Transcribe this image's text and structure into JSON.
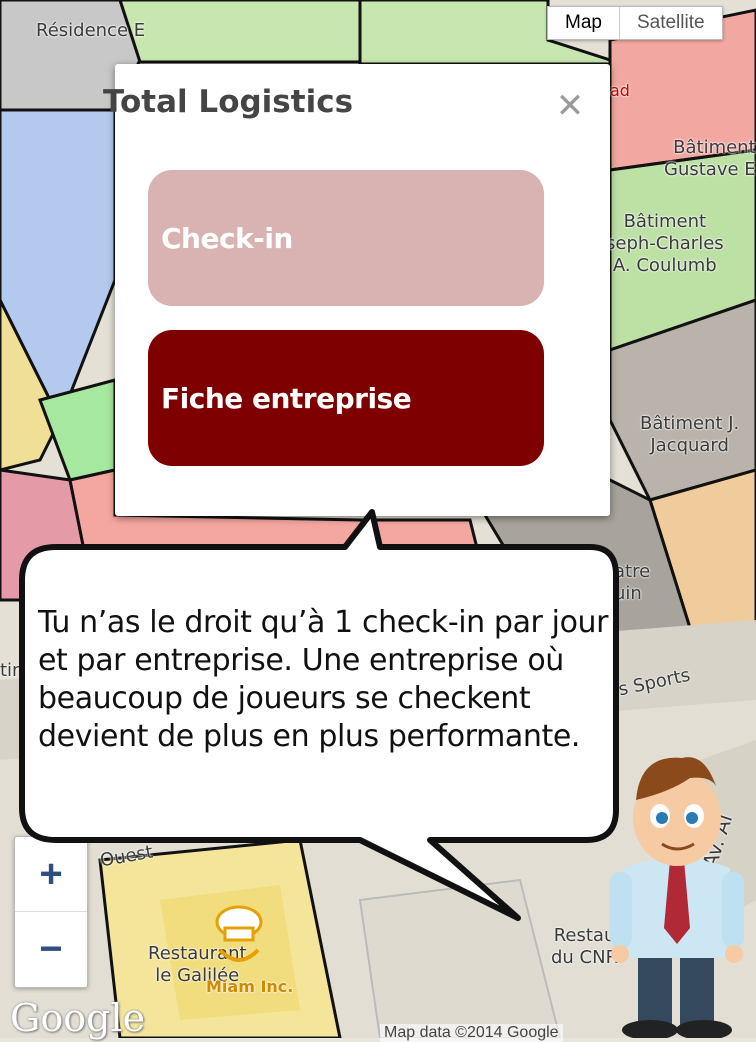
{
  "map": {
    "labels": {
      "residence": "Résidence E",
      "gustave": "Bâtiment\nGustave E",
      "coulumb": "Bâtiment\nseph-Charles\nA. Coulumb",
      "jacquard": "Bâtiment J.\nJacquard",
      "theatre": "atre\nuin",
      "sports": "s Sports",
      "restaurant": "Restaurant\nle Galilée",
      "restau_cnr": "Restau\ndu CNR",
      "avenue": "Av. Al",
      "ouest": "Ouest",
      "tin": "tin",
      "miam": "Miam Inc.",
      "ad": "ad"
    },
    "map_type": {
      "map": "Map",
      "satellite": "Satellite",
      "selected": "Map"
    },
    "zoom": {
      "in": "+",
      "out": "−"
    },
    "google_logo": "Google",
    "attribution": "Map data ©2014 Google"
  },
  "popup": {
    "title": "Total Logistics",
    "close_icon": "close-icon",
    "buttons": {
      "checkin": "Check-in",
      "fiche": "Fiche entreprise"
    }
  },
  "speech_bubble": {
    "text": "Tu n’as le droit qu’à 1 check-in par jour et par entreprise. Une entreprise où beaucoup de joueurs se checkent devient de plus en plus performante."
  },
  "colors": {
    "checkin_button": "#d9b3b1",
    "fiche_button": "#7e0000",
    "popup_title": "#454545"
  }
}
